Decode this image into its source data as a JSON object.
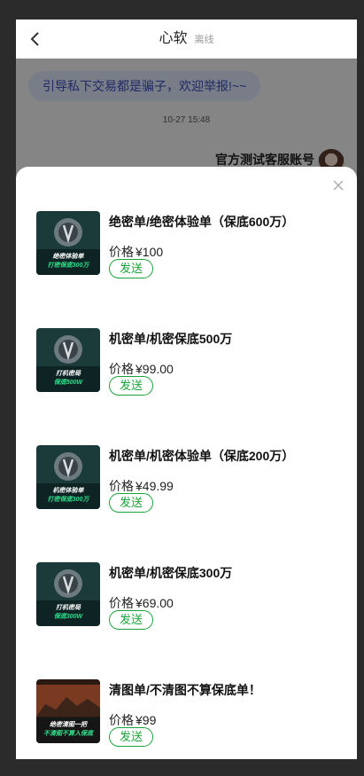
{
  "header": {
    "title": "心软",
    "status": "离线"
  },
  "chat": {
    "notice": "引导私下交易都是骗子，欢迎举报!~~",
    "time": "10-27 15:48",
    "agent_name": "官方测试客服账号"
  },
  "sheet": {
    "price_label": "价格",
    "currency": "¥",
    "send_label": "发送",
    "items": [
      {
        "name": "绝密单/绝密体验单（保底600万）",
        "price": "100",
        "thumb_line1": "绝密体验单",
        "thumb_line2": "打密保底300万"
      },
      {
        "name": "机密单/机密保底500万",
        "price": "99.00",
        "thumb_line1": "打机密局",
        "thumb_line2": "保底500W"
      },
      {
        "name": "机密单/机密体验单（保底200万）",
        "price": "49.99",
        "thumb_line1": "机密体验单",
        "thumb_line2": "打密保底300万"
      },
      {
        "name": "机密单/机密保底300万",
        "price": "69.00",
        "thumb_line1": "打机密局",
        "thumb_line2": "保底300W"
      },
      {
        "name": "清图单/不清图不算保底单！",
        "price": "99",
        "thumb_line1": "绝密清图一把",
        "thumb_line2": "不清图不算入保底"
      }
    ]
  },
  "colors": {
    "accent_green": "#19a33a",
    "notice_bg": "#dde3f8",
    "notice_text": "#3b4fb8"
  }
}
